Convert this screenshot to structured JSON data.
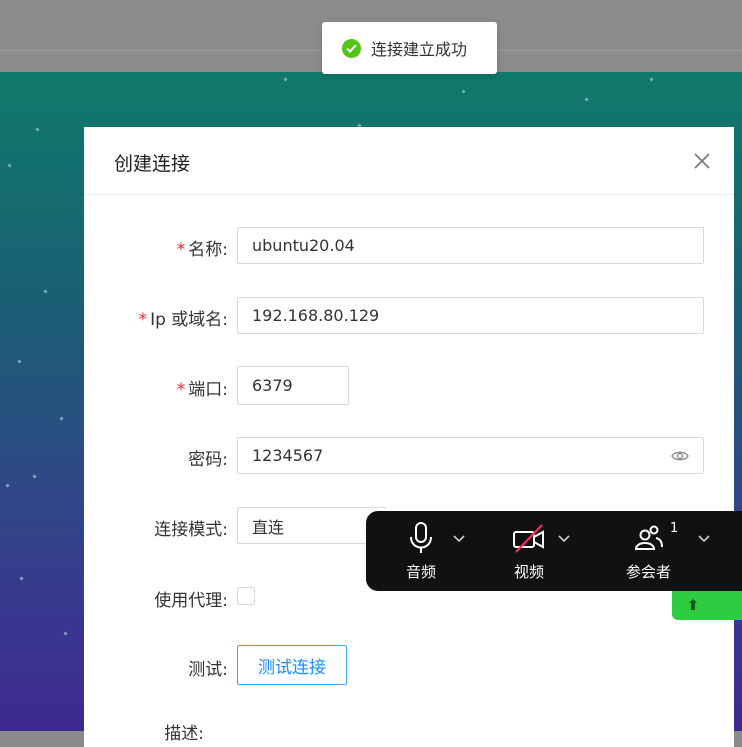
{
  "toast": {
    "message": "连接建立成功",
    "icon": "check-circle-icon",
    "color": "#52c41a"
  },
  "dialog": {
    "title": "创建连接",
    "fields": {
      "name": {
        "label": "名称:",
        "value": "ubuntu20.04",
        "required": true
      },
      "host": {
        "label": "Ip 或域名:",
        "value": "192.168.80.129",
        "required": true
      },
      "port": {
        "label": "端口:",
        "value": "6379",
        "required": true
      },
      "password": {
        "label": "密码:",
        "value": "1234567"
      },
      "mode": {
        "label": "连接模式:",
        "value": "直连"
      },
      "proxy": {
        "label": "使用代理:",
        "checked": false
      },
      "test": {
        "label": "测试:",
        "button": "测试连接"
      },
      "desc": {
        "label": "描述:"
      }
    },
    "required_mark": "*"
  },
  "meeting_bar": {
    "audio": "音频",
    "video": "视频",
    "participants": "参会者",
    "participant_count": "1"
  },
  "colors": {
    "accent": "#1890ff",
    "required": "#f5222d",
    "success": "#52c41a"
  }
}
